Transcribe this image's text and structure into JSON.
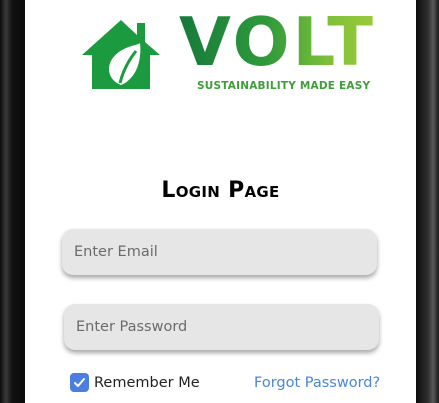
{
  "logo": {
    "wordmark": "VOLT",
    "tagline": "SUSTAINABILITY MADE EASY",
    "icon": "house-leaf-icon",
    "colors": {
      "dark_green": "#1c9a3f",
      "light_green": "#9ccb3b"
    }
  },
  "page": {
    "title": "Login Page"
  },
  "form": {
    "email_placeholder": "Enter Email",
    "password_placeholder": "Enter Password",
    "remember_label": "Remember Me",
    "remember_checked": true,
    "forgot_label": "Forgot Password?"
  },
  "colors": {
    "checkbox": "#4a7fe0",
    "link": "#4a86d9",
    "field_bg": "#e6e6e6"
  }
}
